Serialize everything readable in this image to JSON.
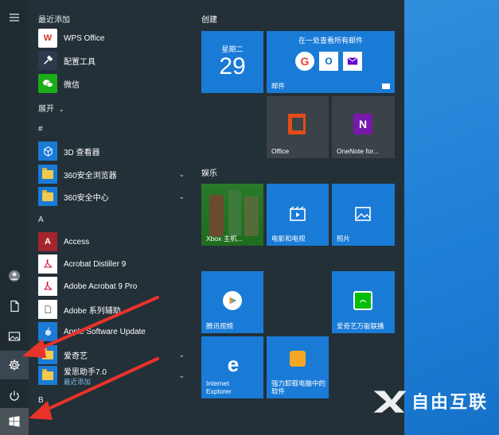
{
  "menu": {
    "recent_header": "最近添加",
    "expand_label": "展开",
    "section_hash": "#",
    "section_a": "A",
    "section_b": "B"
  },
  "recent_apps": [
    {
      "name": "WPS Office",
      "icon": "wps-icon"
    },
    {
      "name": "配置工具",
      "icon": "tools-icon"
    },
    {
      "name": "微信",
      "icon": "wechat-icon"
    }
  ],
  "apps": [
    {
      "name": "3D 查看器",
      "icon": "cube-icon"
    },
    {
      "name": "360安全浏览器",
      "icon": "folder-icon"
    },
    {
      "name": "360安全中心",
      "icon": "folder-icon"
    },
    {
      "name": "Access",
      "icon": "access-icon"
    },
    {
      "name": "Acrobat Distiller 9",
      "icon": "acrobat-icon"
    },
    {
      "name": "Adobe Acrobat 9 Pro",
      "icon": "acrobat-icon"
    },
    {
      "name": "Adobe 系列辅助",
      "icon": "document-icon"
    },
    {
      "name": "Apple Software Update",
      "icon": "apple-icon"
    },
    {
      "name": "爱奇艺",
      "icon": "folder-icon"
    },
    {
      "name": "爱思助手7.0",
      "sub": "最近添加",
      "icon": "folder-icon"
    }
  ],
  "tile_groups": {
    "create": "创建",
    "entertainment": "娱乐"
  },
  "tiles": {
    "calendar_day": "星期二",
    "calendar_date": "29",
    "mail_header": "在一处查看所有邮件",
    "mail_label": "邮件",
    "office_label": "Office",
    "onenote_label": "OneNote for...",
    "xbox_label": "Xbox 主机...",
    "movies_label": "电影和电视",
    "photos_label": "照片",
    "tencent_label": "腾讯视频",
    "iqiyi_label": "爱奇艺万能联播",
    "ie_label": "Internet Explorer",
    "uninstall_label": "强力卸载电脑中的软件"
  },
  "watermark": "自由互联",
  "colors": {
    "tile_blue": "#1a7bd7",
    "tile_gray": "#3b4348",
    "arrow_red": "#e8332a",
    "panel": "#233038"
  }
}
